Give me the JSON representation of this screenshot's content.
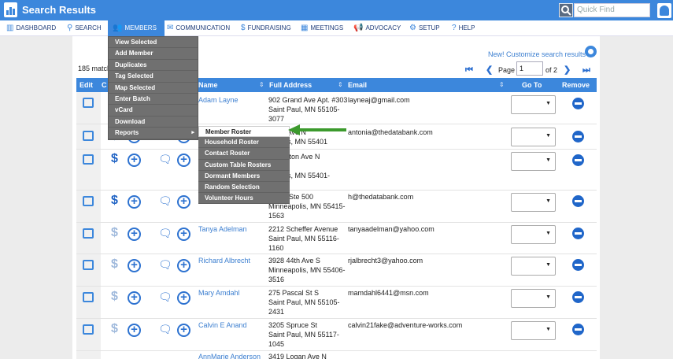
{
  "app": {
    "title": "Search Results",
    "quick_find_placeholder": "Quick Find"
  },
  "nav": {
    "dashboard": "DASHBOARD",
    "search": "SEARCH",
    "members": "MEMBERS",
    "communication": "COMMUNICATION",
    "fundraising": "FUNDRAISING",
    "meetings": "MEETINGS",
    "advocacy": "ADVOCACY",
    "setup": "SETUP",
    "help": "HELP"
  },
  "members_menu": {
    "items": [
      "View Selected",
      "Add Member",
      "Duplicates",
      "Tag Selected",
      "Map Selected",
      "Enter Batch",
      "vCard",
      "Download",
      "Reports"
    ],
    "caret": "▸"
  },
  "reports_submenu": {
    "items": [
      "Member Roster",
      "Household Roster",
      "Contact Roster",
      "Custom Table Rosters",
      "Dormant Members",
      "Random Selection",
      "Volunteer Hours"
    ]
  },
  "toolbar": {
    "customize": "New! Customize search results ➔",
    "matches": "185 match",
    "page_label": "Page",
    "page_value": "1",
    "of_pages": "of 2",
    "first": "⏮",
    "prev": "❮",
    "next": "❯",
    "last": "⏭"
  },
  "table": {
    "headers": {
      "edit": "Edit",
      "c": "C",
      "name": "Name",
      "address": "Full Address",
      "email": "Email",
      "goto": "Go To",
      "remove": "Remove"
    },
    "sort_icon": "⇕",
    "rows": [
      {
        "name": "Adam Layne",
        "addr": [
          "902 Grand Ave Apt. #303",
          "Saint Paul, MN 55105-",
          "3077"
        ],
        "email": "layneaj@gmail.com",
        "dollar": "$"
      },
      {
        "name": "",
        "addr": [
          "nylon Ave N",
          "eapolis, MN 55401"
        ],
        "email": "antonia@thedatabank.com",
        "dollar": "$"
      },
      {
        "name": "",
        "addr": [
          "ashington Ave N",
          "0",
          "eapolis, MN 55401-"
        ],
        "email": "",
        "dollar": "$"
      },
      {
        "name": "",
        "addr": [
          "5th St Ste 500",
          "Minneapolis, MN 55415-",
          "1563"
        ],
        "email": "h@thedatabank.com",
        "dollar": "$"
      },
      {
        "name": "Tanya Adelman",
        "addr": [
          "2212 Scheffer Avenue",
          "Saint Paul, MN 55116-",
          "1160"
        ],
        "email": "tanyaadelman@yahoo.com",
        "dollar": "$"
      },
      {
        "name": "Richard Albrecht",
        "addr": [
          "3928 44th Ave S",
          "Minneapolis, MN 55406-",
          "3516"
        ],
        "email": "rjalbrecht3@yahoo.com",
        "dollar": "$"
      },
      {
        "name": "Mary Amdahl",
        "addr": [
          "275 Pascal St S",
          "Saint Paul, MN 55105-",
          "2431"
        ],
        "email": "mamdahl6441@msn.com",
        "dollar": "$"
      },
      {
        "name": "Calvin E Anand",
        "addr": [
          "3205 Spruce St",
          "Saint Paul, MN 55117-",
          "1045"
        ],
        "email": "calvin21fake@adventure-works.com",
        "dollar": "$"
      },
      {
        "name": "AnnMarie Anderson",
        "addr": [
          "3419 Logan Ave N"
        ],
        "email": "",
        "dollar": "$"
      }
    ],
    "plus_glyph": "+",
    "chat_glyph": "🗨",
    "caret_glyph": "▼"
  },
  "icons": [
    "dashboard-icon",
    "search-icon",
    "members-icon",
    "envelope-icon",
    "dollar-icon",
    "calendar-icon",
    "megaphone-icon",
    "gear-icon",
    "help-icon",
    "edit-icon",
    "plus-circle-icon",
    "chat-icon",
    "remove-icon",
    "user-icon"
  ],
  "colors": {
    "accent": "#3c87dc",
    "menu_bg": "#707070",
    "arrow": "#3c9a2d",
    "link": "#3c7fd0"
  }
}
